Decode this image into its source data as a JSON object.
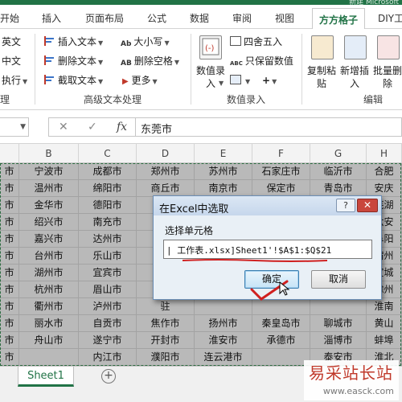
{
  "window": {
    "doc_title_partial": "新建 Microsoft"
  },
  "ribbon_tabs": [
    "开始",
    "插入",
    "页面布局",
    "公式",
    "数据",
    "审阅",
    "视图",
    "方方格子",
    "DIY工"
  ],
  "active_tab": "方方格子",
  "ribbon": {
    "left_items": [
      "英文",
      "中文",
      "执行"
    ],
    "left_group_partial": "理",
    "text_col1": [
      "插入文本",
      "删除文本",
      "截取文本"
    ],
    "text_col2": [
      "大小写",
      "删除空格",
      "更多"
    ],
    "text_col2_icons": [
      "Ab",
      "AB",
      ""
    ],
    "text_group": "高级文本处理",
    "numeric": {
      "big_button": "数值录入",
      "items": [
        "四舍五入",
        "只保留数值"
      ],
      "only_value_icon": "ABC",
      "extra_icons": [
        "edit-icon",
        "plus-icon"
      ]
    },
    "numeric_group": "数值录入",
    "edit_buttons": [
      "复制粘贴",
      "新增插入",
      "批量删除"
    ],
    "edit_group": "编辑"
  },
  "formula_bar": {
    "value": "东莞市",
    "cancel": "✕",
    "enter": "✓",
    "fx": "fx"
  },
  "columns": [
    "",
    "B",
    "C",
    "D",
    "E",
    "F",
    "G",
    "H"
  ],
  "rows": [
    [
      "市",
      "宁波市",
      "成都市",
      "郑州市",
      "苏州市",
      "石家庄市",
      "临沂市",
      "合肥"
    ],
    [
      "市",
      "温州市",
      "绵阳市",
      "商丘市",
      "南京市",
      "保定市",
      "青岛市",
      "安庆"
    ],
    [
      "市",
      "金华市",
      "德阳市",
      "",
      "",
      "",
      "",
      "芜湖"
    ],
    [
      "市",
      "绍兴市",
      "南充市",
      "",
      "",
      "",
      "",
      "六安"
    ],
    [
      "市",
      "嘉兴市",
      "达州市",
      "",
      "",
      "",
      "",
      "阜阳"
    ],
    [
      "市",
      "台州市",
      "乐山市",
      "",
      "",
      "",
      "",
      "宿州"
    ],
    [
      "市",
      "湖州市",
      "宜宾市",
      "",
      "",
      "",
      "",
      "宣城"
    ],
    [
      "市",
      "杭州市",
      "眉山市",
      "",
      "",
      "",
      "",
      "滁州"
    ],
    [
      "市",
      "衢州市",
      "泸州市",
      "驻",
      "",
      "",
      "",
      "淮南"
    ],
    [
      "市",
      "丽水市",
      "自贡市",
      "焦作市",
      "扬州市",
      "秦皇岛市",
      "聊城市",
      "黄山"
    ],
    [
      "市",
      "舟山市",
      "遂宁市",
      "开封市",
      "淮安市",
      "承德市",
      "淄博市",
      "蚌埠"
    ],
    [
      "市",
      "",
      "内江市",
      "濮阳市",
      "连云港市",
      "",
      "泰安市",
      "淮北"
    ],
    [
      "市",
      "",
      "广元市",
      "平顶山市",
      "镇江市",
      "",
      "日照市",
      "池州"
    ],
    [
      "市",
      "",
      "巴中市",
      "信阳市",
      "",
      "",
      "",
      ""
    ]
  ],
  "sheet_tab": "Sheet1",
  "add_sheet": "+",
  "dialog": {
    "title": "在Excel中选取",
    "help": "?",
    "close": "✕",
    "label": "选择单元格",
    "input_value": "| 工作表.xlsx]Sheet1'!$A$1:$Q$21",
    "ok": "确定",
    "cancel": "取消"
  },
  "watermark": {
    "main": "易采站长站",
    "url": "www.easck.com"
  }
}
